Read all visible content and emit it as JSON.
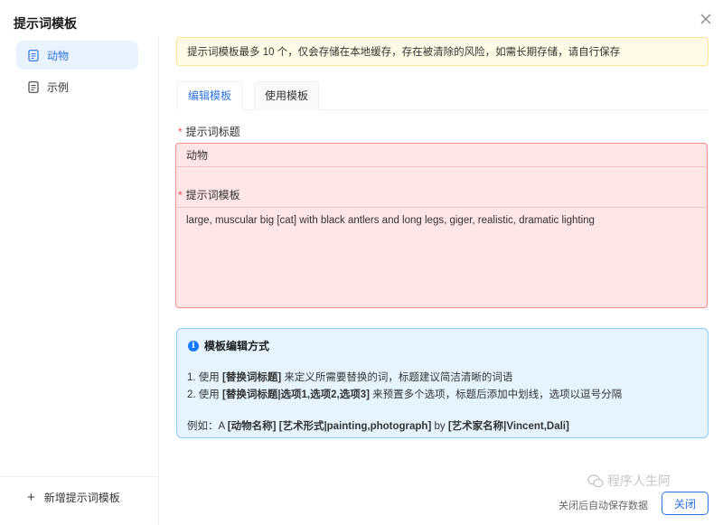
{
  "dialog": {
    "title": "提示词模板"
  },
  "sidebar": {
    "items": [
      {
        "label": "动物",
        "active": true
      },
      {
        "label": "示例",
        "active": false
      }
    ],
    "add_label": "新增提示词模板"
  },
  "notice": {
    "text": "提示词模板最多 10 个，仅会存储在本地缓存，存在被清除的风险，如需长期存储，请自行保存"
  },
  "tabs": [
    {
      "label": "编辑模板",
      "active": true
    },
    {
      "label": "使用模板",
      "active": false
    }
  ],
  "form": {
    "title_label": "提示词标题",
    "title_value": "动物",
    "template_label": "提示词模板",
    "template_value": "large, muscular big [cat] with black antlers and long legs, giger, realistic, dramatic lighting"
  },
  "help": {
    "heading": "模板编辑方式",
    "line1_prefix": "1. 使用 ",
    "line1_bold": "[替换词标题]",
    "line1_suffix": " 来定义所需要替换的词，标题建议简洁清晰的词语",
    "line2_prefix": "2. 使用 ",
    "line2_bold": "[替换词标题|选项1,选项2,选项3]",
    "line2_suffix": " 来预置多个选项，标题后添加中划线，选项以逗号分隔",
    "example_prefix": "例如：A ",
    "example_b1": "[动物名称]",
    "example_b2": "[艺术形式|painting,photograph]",
    "example_mid": " by ",
    "example_b3": "[艺术家名称|Vincent,Dali]"
  },
  "footer": {
    "note": "关闭后自动保存数据",
    "close_label": "关闭"
  },
  "watermark": {
    "text": "程序人生阿"
  },
  "colors": {
    "accent": "#2b74e2",
    "error_bg": "#ffe6e6",
    "error_border": "#ff8a8a",
    "warning_bg": "#fffbe6",
    "info_bg": "#e6f4ff"
  }
}
